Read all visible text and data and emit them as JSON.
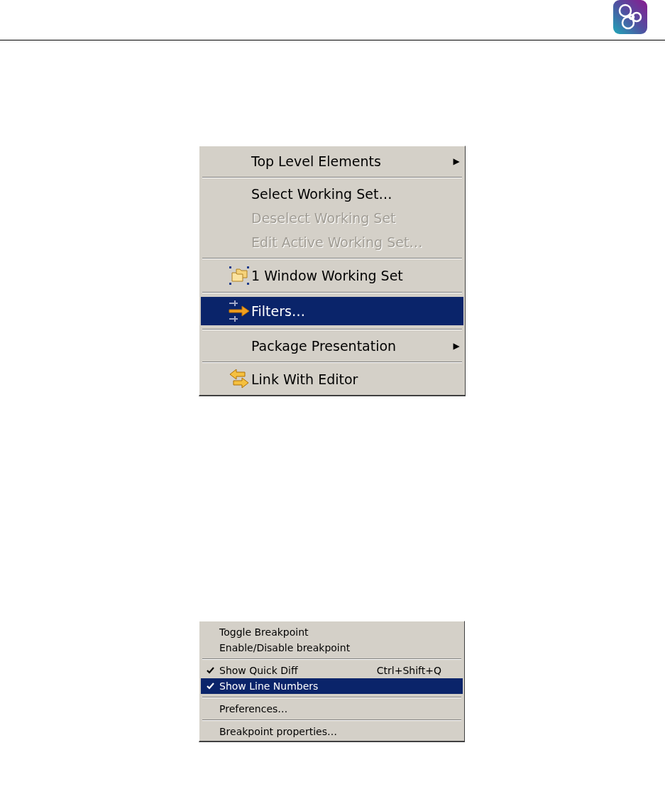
{
  "context_menus": [
    {
      "items": [
        {
          "kind": "submenu",
          "label": "Top Level Elements",
          "selected": false,
          "disabled": false,
          "arrow": "▶"
        },
        {
          "kind": "separator"
        },
        {
          "kind": "text",
          "label": "Select Working Set…",
          "selected": false,
          "disabled": false
        },
        {
          "kind": "text",
          "label": "Deselect Working Set",
          "selected": false,
          "disabled": true
        },
        {
          "kind": "text",
          "label": "Edit Active Working Set…",
          "selected": false,
          "disabled": true
        },
        {
          "kind": "separator"
        },
        {
          "kind": "folder",
          "label": "1 Window Working Set",
          "selected": false,
          "disabled": false
        },
        {
          "kind": "separator"
        },
        {
          "kind": "filter",
          "label": "Filters…",
          "selected": true,
          "disabled": false
        },
        {
          "kind": "separator"
        },
        {
          "kind": "submenu",
          "label": "Package Presentation",
          "selected": false,
          "disabled": false,
          "arrow": "▶"
        },
        {
          "kind": "separator"
        },
        {
          "kind": "link",
          "label": "Link With Editor",
          "selected": false,
          "disabled": false
        }
      ]
    },
    {
      "items": [
        {
          "kind": "text",
          "label": "Toggle Breakpoint",
          "selected": false,
          "checked": false
        },
        {
          "kind": "text",
          "label": "Enable/Disable breakpoint",
          "selected": false,
          "checked": false
        },
        {
          "kind": "separator"
        },
        {
          "kind": "text",
          "label": "Show Quick Diff",
          "shortcut": "Ctrl+Shift+Q",
          "selected": false,
          "checked": true
        },
        {
          "kind": "text",
          "label": "Show Line Numbers",
          "selected": true,
          "checked": true
        },
        {
          "kind": "separator"
        },
        {
          "kind": "text",
          "label": "Preferences…",
          "selected": false,
          "checked": false
        },
        {
          "kind": "separator"
        },
        {
          "kind": "text",
          "label": "Breakpoint properties…",
          "selected": false,
          "checked": false
        }
      ]
    }
  ]
}
